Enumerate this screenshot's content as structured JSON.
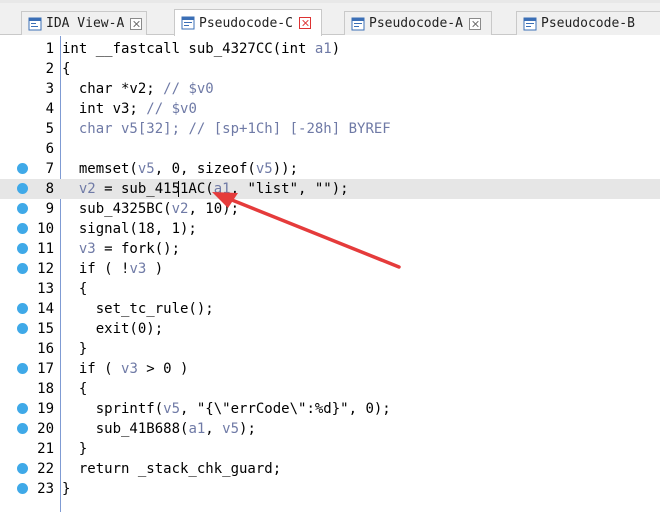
{
  "tabs": [
    {
      "label": "IDA View-A",
      "active": false
    },
    {
      "label": "Pseudocode-C",
      "active": true
    },
    {
      "label": "Pseudocode-A",
      "active": false
    },
    {
      "label": "Pseudocode-B",
      "active": false
    }
  ],
  "code_lines": [
    {
      "num": "1",
      "bp": false,
      "text": "int __fastcall sub_4327CC(int a1)"
    },
    {
      "num": "2",
      "bp": false,
      "text": "{"
    },
    {
      "num": "3",
      "bp": false,
      "text": "  char *v2; // $v0"
    },
    {
      "num": "4",
      "bp": false,
      "text": "  int v3; // $v0"
    },
    {
      "num": "5",
      "bp": false,
      "text": "  char v5[32]; // [sp+1Ch] [-28h] BYREF"
    },
    {
      "num": "6",
      "bp": false,
      "text": ""
    },
    {
      "num": "7",
      "bp": true,
      "text": "  memset(v5, 0, sizeof(v5));"
    },
    {
      "num": "8",
      "bp": true,
      "text": "  v2 = sub_4151AC(a1, \"list\", \"\");"
    },
    {
      "num": "9",
      "bp": true,
      "text": "  sub_4325BC(v2, 10);"
    },
    {
      "num": "10",
      "bp": true,
      "text": "  signal(18, 1);"
    },
    {
      "num": "11",
      "bp": true,
      "text": "  v3 = fork();"
    },
    {
      "num": "12",
      "bp": true,
      "text": "  if ( !v3 )"
    },
    {
      "num": "13",
      "bp": false,
      "text": "  {"
    },
    {
      "num": "14",
      "bp": true,
      "text": "    set_tc_rule();"
    },
    {
      "num": "15",
      "bp": true,
      "text": "    exit(0);"
    },
    {
      "num": "16",
      "bp": false,
      "text": "  }"
    },
    {
      "num": "17",
      "bp": true,
      "text": "  if ( v3 > 0 )"
    },
    {
      "num": "18",
      "bp": false,
      "text": "  {"
    },
    {
      "num": "19",
      "bp": true,
      "text": "    sprintf(v5, \"{\\\"errCode\\\":%d}\", 0);"
    },
    {
      "num": "20",
      "bp": true,
      "text": "    sub_41B688(a1, v5);"
    },
    {
      "num": "21",
      "bp": false,
      "text": "  }"
    },
    {
      "num": "22",
      "bp": true,
      "text": "  return _stack_chk_guard;"
    },
    {
      "num": "23",
      "bp": true,
      "text": "}"
    }
  ],
  "current_line": "8",
  "colors": {
    "breakpoint": "#3fa9e8",
    "variable": "#6f7aa6",
    "arrow": "#e53b3b",
    "current_line_bg": "#e6e6e6"
  }
}
